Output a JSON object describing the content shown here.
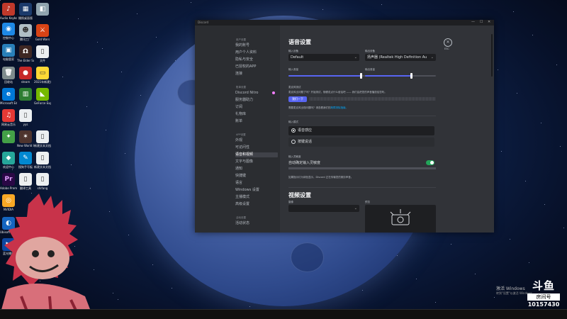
{
  "desktop": {
    "icons_col1": [
      "Audio Keyboard",
      "控制中心",
      "电脑管家",
      "回收站",
      "Microsoft Edge",
      "网易云音乐",
      "",
      "欢迎中心",
      "Adobe Premie",
      "NVIDIA",
      "Ubisoft Connect",
      "蓝光播放"
    ],
    "icons_col2": [
      "撮照桌面版",
      "腾讯工厂",
      "The Elder Scrolls",
      "steam",
      "",
      "yys",
      "New World Closed Beta",
      "搜狗手写板",
      "翻译工具",
      "",
      "",
      ""
    ],
    "icons_col3": [
      "",
      "Gold Wars",
      "文件",
      "2021年新建文件",
      "GeForce Experience",
      "",
      "新建文本文档",
      "新建文本文档(2)",
      "shifang",
      "",
      "",
      ""
    ]
  },
  "window": {
    "title": "Discord",
    "controls": [
      "—",
      "☐",
      "✕"
    ]
  },
  "sidebar": {
    "head_user": "用户设置",
    "user_items": [
      "我的账号",
      "用户个人资料",
      "隐私与安全",
      "已授权的APP",
      "连接"
    ],
    "head_billing": "账单设置",
    "billing_items": [
      "Discord Nitro",
      "服务器助力",
      "订阅",
      "礼物库",
      "账单"
    ],
    "head_app": "APP设置",
    "app_items": [
      "外观",
      "可访问性",
      "语音和视频",
      "文字与图像",
      "通知",
      "快捷键",
      "语言",
      "Windows 设置",
      "主播模式",
      "高级设置"
    ],
    "head_activity": "活动设置",
    "activity_items": [
      "活动状态"
    ]
  },
  "voice": {
    "title": "语音设置",
    "input_device_label": "输入设备",
    "input_device": "Default",
    "output_device_label": "输出设备",
    "output_device": "扬声器 (Realtek High Definition Au",
    "input_volume_label": "输入音量",
    "output_volume_label": "输出音量",
    "input_volume": 0.8,
    "output_volume": 0.65,
    "mic_test_label": "麦克风测试",
    "mic_test_desc": "麦克风出问题了吗？开始测试，随便说点什么傻话吧 —— 我们会把您的声音播放给您听。",
    "mic_test_button": "我们一下",
    "help_text": "需要麦克风出现问题吗？请查看我们的",
    "help_link": "故障排除指南。",
    "input_mode_label": "输入模式",
    "input_modes": [
      "语音感应",
      "按键说话"
    ],
    "sensitivity_label": "输入灵敏度",
    "sensitivity_toggle_label": "自动确定输入灵敏度",
    "sensitivity_desc": "如果指示灯为绿色显示，Discord 正在传输您的美妙声音。"
  },
  "video": {
    "title": "视频设置",
    "camera_label": "摄像",
    "preview_label": "预览"
  },
  "close_label": "ESC",
  "overlay": {
    "activation_title": "激活 Windows",
    "activation_sub": "转到\"设置\"以激活 Windows。",
    "brand": "斗鱼",
    "room_label": "房间号",
    "room_number": "10157430"
  }
}
